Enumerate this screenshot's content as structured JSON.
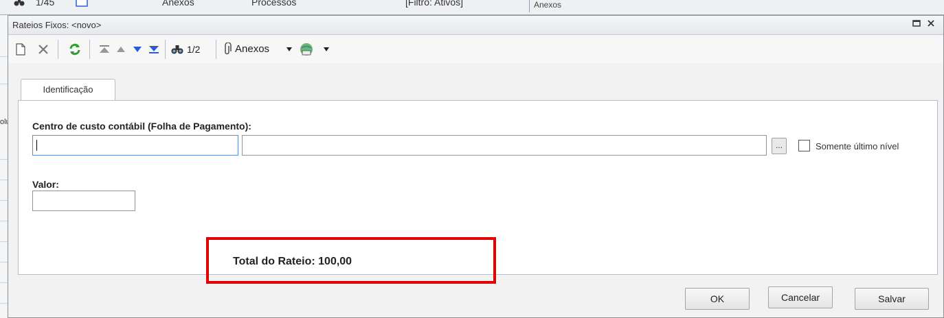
{
  "background": {
    "toolbar": {
      "record_counter": "1/45",
      "attachments_label": "Anexos",
      "processes_label": "Processos",
      "filter_label": "[Filtro: Ativos]"
    },
    "right_tab": "Anexos",
    "left_strip_text": "olu"
  },
  "dialog": {
    "title": "Rateios Fixos: <novo>",
    "toolbar": {
      "record_counter": "1/2",
      "attachments_label": "Anexos"
    },
    "tabs": [
      {
        "label": "Identificação",
        "active": true
      }
    ],
    "form": {
      "cost_center_label": "Centro de custo contábil (Folha de Pagamento):",
      "cost_center_code_value": "",
      "cost_center_description_value": "",
      "lookup_button_label": "...",
      "only_last_level_label": "Somente último nível",
      "only_last_level_checked": false,
      "value_label": "Valor:",
      "value_value": "",
      "total_text": "Total do Rateio: 100,00"
    },
    "buttons": {
      "ok": "OK",
      "cancel": "Cancelar",
      "save": "Salvar"
    }
  },
  "colors": {
    "highlight": "#e00000",
    "focus_border": "#5a8ed1",
    "refresh_icon": "#2f9e2f",
    "nav_arrow": "#2a5bd7"
  }
}
